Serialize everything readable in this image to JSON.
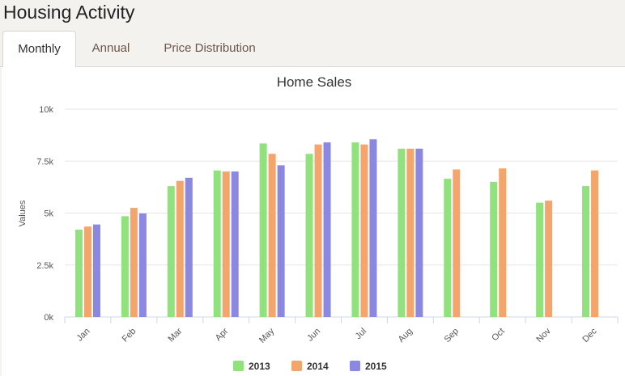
{
  "page": {
    "title": "Housing Activity"
  },
  "tabs": [
    {
      "label": "Monthly",
      "active": true
    },
    {
      "label": "Annual",
      "active": false
    },
    {
      "label": "Price Distribution",
      "active": false
    }
  ],
  "chart_data": {
    "type": "bar",
    "title": "Home Sales",
    "xlabel": "",
    "ylabel": "Values",
    "ylim": [
      0,
      10000
    ],
    "yticks": [
      0,
      2500,
      5000,
      7500,
      10000
    ],
    "ytick_labels": [
      "0k",
      "2.5k",
      "5k",
      "7.5k",
      "10k"
    ],
    "categories": [
      "Jan",
      "Feb",
      "Mar",
      "Apr",
      "May",
      "Jun",
      "Jul",
      "Aug",
      "Sep",
      "Oct",
      "Nov",
      "Dec"
    ],
    "series": [
      {
        "name": "2013",
        "color": "#90e27d",
        "values": [
          4200,
          4850,
          6300,
          7050,
          8350,
          7850,
          8400,
          8100,
          6650,
          6500,
          5500,
          6300
        ]
      },
      {
        "name": "2014",
        "color": "#f4a56c",
        "values": [
          4350,
          5250,
          6550,
          7000,
          7850,
          8300,
          8300,
          8100,
          7100,
          7150,
          5600,
          7050
        ]
      },
      {
        "name": "2015",
        "color": "#8a88e0",
        "values": [
          4450,
          4980,
          6700,
          7000,
          7300,
          8400,
          8550,
          8100,
          null,
          null,
          null,
          null
        ]
      }
    ],
    "grid": true,
    "legend_position": "bottom-center"
  }
}
